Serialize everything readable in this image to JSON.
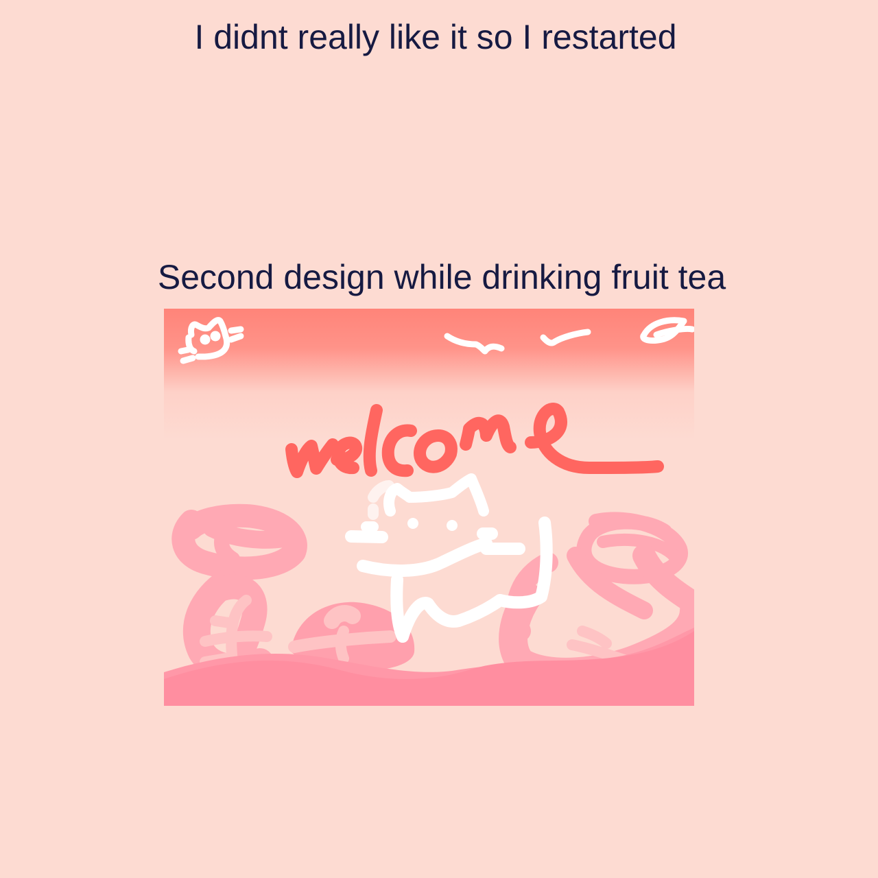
{
  "captions": {
    "top": "I didnt really like it so I restarted",
    "second": "Second design while drinking fruit tea"
  },
  "drawing": {
    "handwritten_text": "welcome",
    "colors": {
      "page_background": "#fddbd2",
      "caption_text": "#161a42",
      "sky_top": "#ff8479",
      "ground": "#ff8ea0",
      "bushes": "#ffa9b4",
      "welcome_text": "#ff6660",
      "doodle_white": "#ffffff"
    }
  }
}
